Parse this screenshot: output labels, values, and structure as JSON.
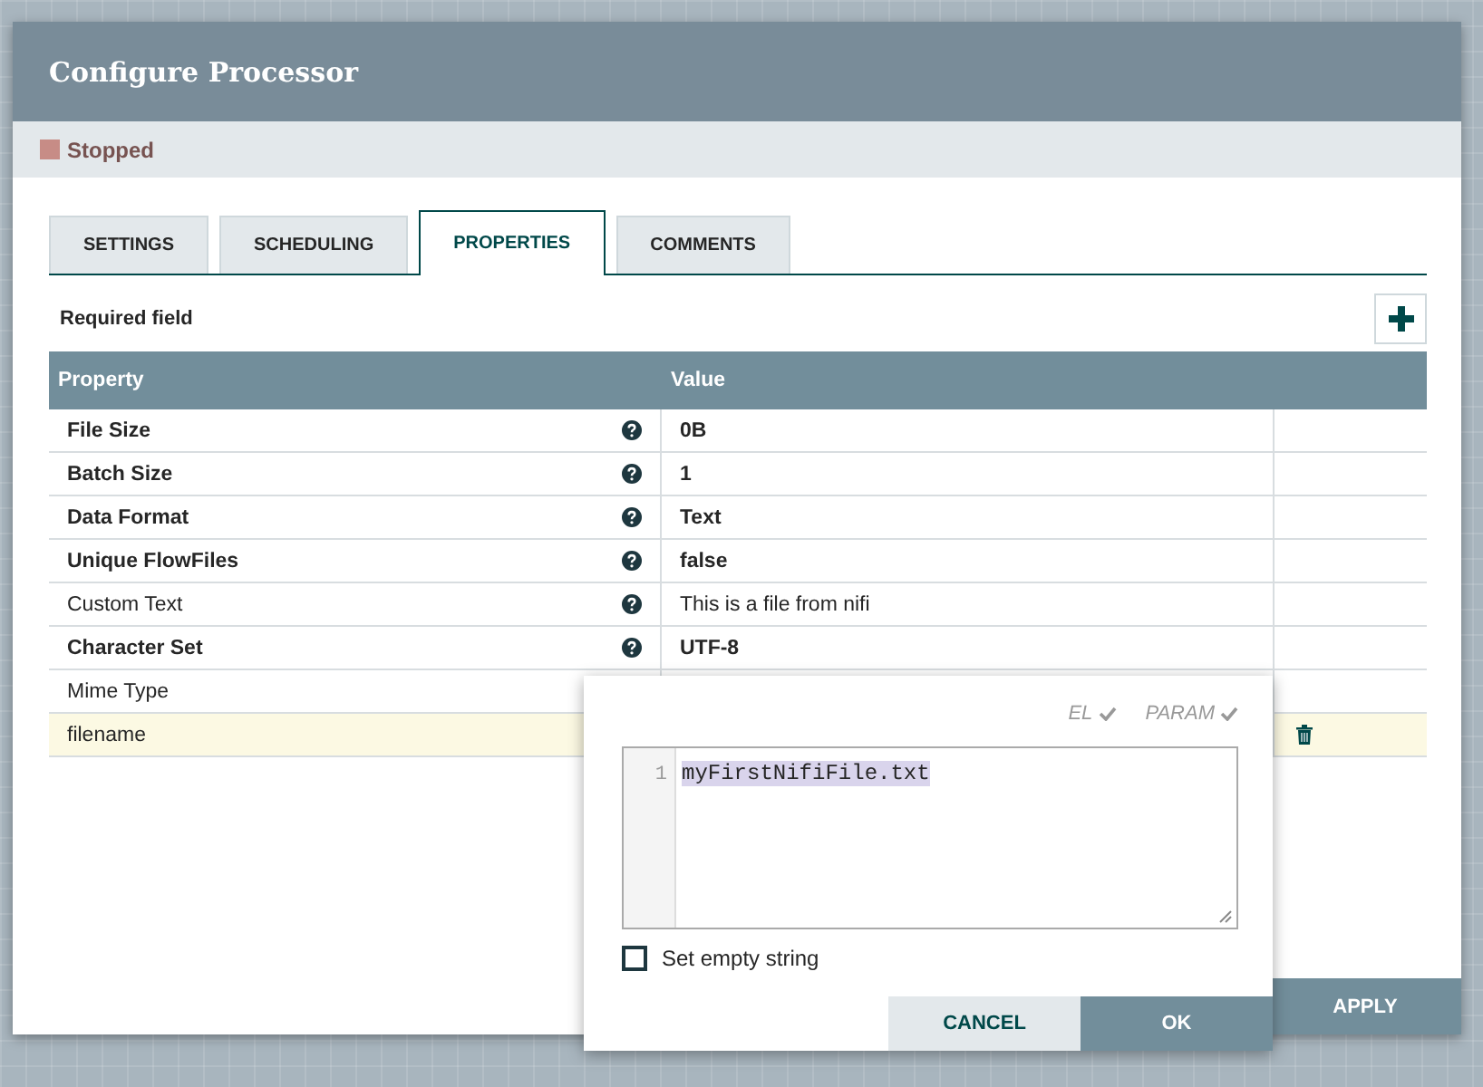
{
  "dialog": {
    "title": "Configure Processor",
    "status": {
      "label": "Stopped",
      "color": "#c78c86"
    }
  },
  "tabs": [
    {
      "label": "SETTINGS",
      "selected": false
    },
    {
      "label": "SCHEDULING",
      "selected": false
    },
    {
      "label": "PROPERTIES",
      "selected": true
    },
    {
      "label": "COMMENTS",
      "selected": false
    }
  ],
  "required_note": "Required field",
  "table": {
    "columns": [
      "Property",
      "Value"
    ],
    "rows": [
      {
        "property": "File Size",
        "value": "0B",
        "required": true,
        "kind": "standard",
        "selected": false
      },
      {
        "property": "Batch Size",
        "value": "1",
        "required": true,
        "kind": "standard",
        "selected": false
      },
      {
        "property": "Data Format",
        "value": "Text",
        "required": true,
        "kind": "standard",
        "selected": false
      },
      {
        "property": "Unique FlowFiles",
        "value": "false",
        "required": true,
        "kind": "standard",
        "selected": false
      },
      {
        "property": "Custom Text",
        "value": "This is a file from nifi",
        "required": false,
        "kind": "standard",
        "selected": false
      },
      {
        "property": "Character Set",
        "value": "UTF-8",
        "required": true,
        "kind": "standard",
        "selected": false
      },
      {
        "property": "Mime Type",
        "required": false,
        "kind": "standard",
        "selected": false
      },
      {
        "property": "filename",
        "required": false,
        "kind": "dynamic",
        "selected": true
      }
    ]
  },
  "footer_button": "APPLY",
  "editor_popup": {
    "badges": [
      "EL",
      "PARAM"
    ],
    "line_number": "1",
    "value": "myFirstNifiFile.txt",
    "empty_string": {
      "label": "Set empty string",
      "checked": false
    },
    "buttons": [
      {
        "label": "CANCEL",
        "kind": "secondary"
      },
      {
        "label": "OK",
        "kind": "primary"
      }
    ]
  }
}
